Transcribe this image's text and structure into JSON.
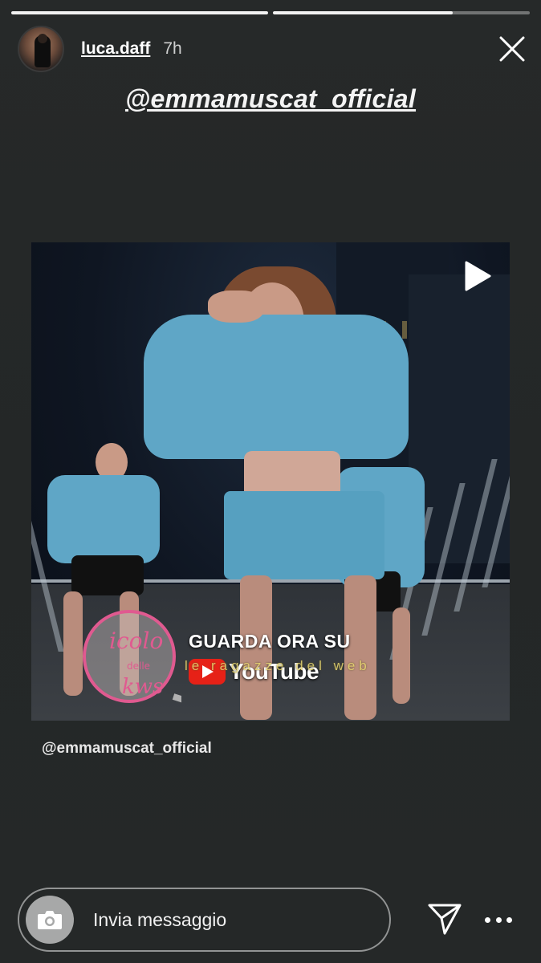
{
  "progress": [
    1.0,
    0.7
  ],
  "header": {
    "username": "luca.daff",
    "time": "7h",
    "close_icon": "close-icon"
  },
  "story": {
    "mention": "@emmamuscat_official",
    "video": {
      "overlay_line1": "GUARDA ORA SU",
      "overlay_brand": "YouTube",
      "watermark_text": "le ragazze del web",
      "play_icon": "play-icon"
    },
    "caption": "@emmamuscat_official"
  },
  "footer": {
    "message_placeholder": "Invia messaggio",
    "camera_icon": "camera-icon",
    "send_icon": "paper-plane-icon",
    "more_icon": "more-dots-icon"
  },
  "colors": {
    "background": "#252828",
    "outfit": "#5fa6c6",
    "youtube_red": "#e62117"
  }
}
